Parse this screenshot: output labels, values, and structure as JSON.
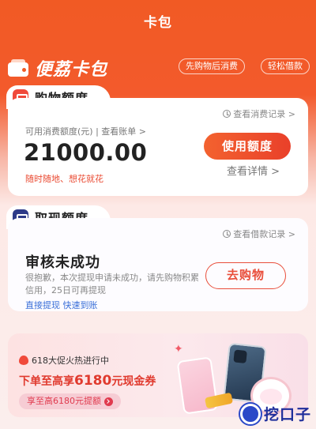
{
  "header": {
    "title": "卡包"
  },
  "brand": {
    "name": "便荔卡包",
    "icon": "wallet-icon"
  },
  "pills": [
    {
      "label": "先购物后消费"
    },
    {
      "label": "轻松借款"
    }
  ],
  "shopping": {
    "tab_label": "购物额度",
    "record_link": "查看消费记录 >",
    "available_label": "可用消费额度(元) | 查看账单 >",
    "amount": "21000.00",
    "note": "随时随地、想花就花",
    "use_button": "使用额度",
    "detail_link": "查看详情 >"
  },
  "cash": {
    "tab_label": "取现额度",
    "record_link": "查看借款记录 >",
    "status_title": "审核未成功",
    "status_desc": "很抱歉，本次提现申请未成功，请先购物积累信用，25日可再提现",
    "quick_links": "直接提现 快速到账",
    "go_shop_button": "去购物"
  },
  "promo": {
    "tag": "618大促火热进行中",
    "title_prefix": "下单至高享",
    "title_amount": "6180",
    "title_suffix": "元现金券",
    "button": "享至高6180元提额"
  },
  "watermark": {
    "text": "挖口子"
  },
  "colors": {
    "brand_orange": "#f15a24",
    "accent_red": "#e9402a",
    "link_blue": "#3a6fd8",
    "tab_icon_blue": "#2d3a88"
  }
}
